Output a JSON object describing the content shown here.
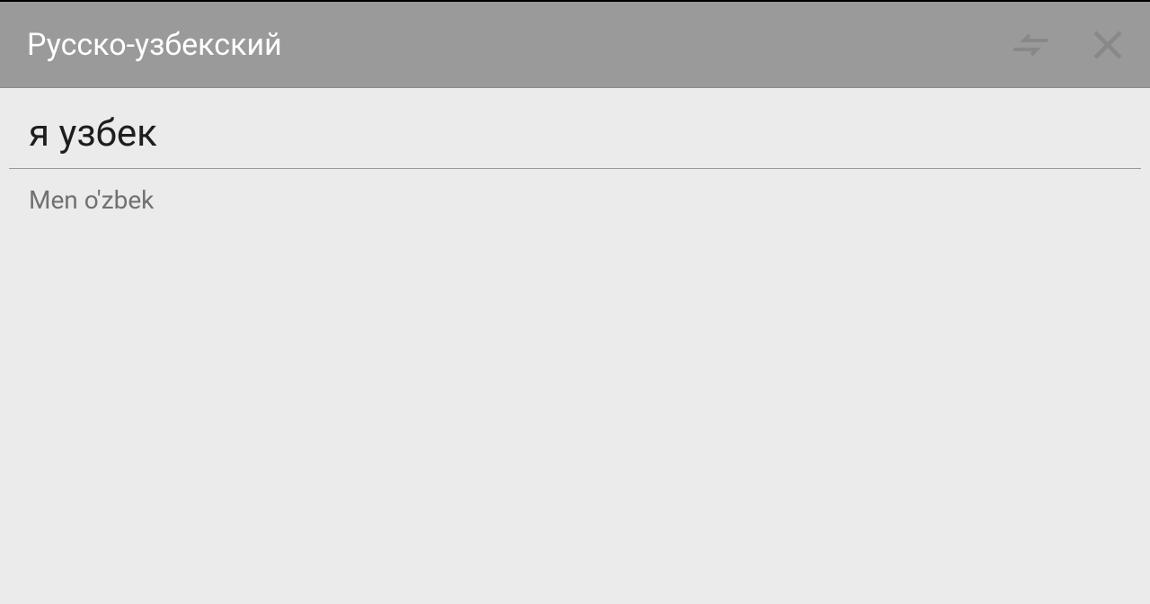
{
  "header": {
    "title": "Русско-узбекский"
  },
  "source_text": "я узбек",
  "translated_text": "Men o'zbek"
}
